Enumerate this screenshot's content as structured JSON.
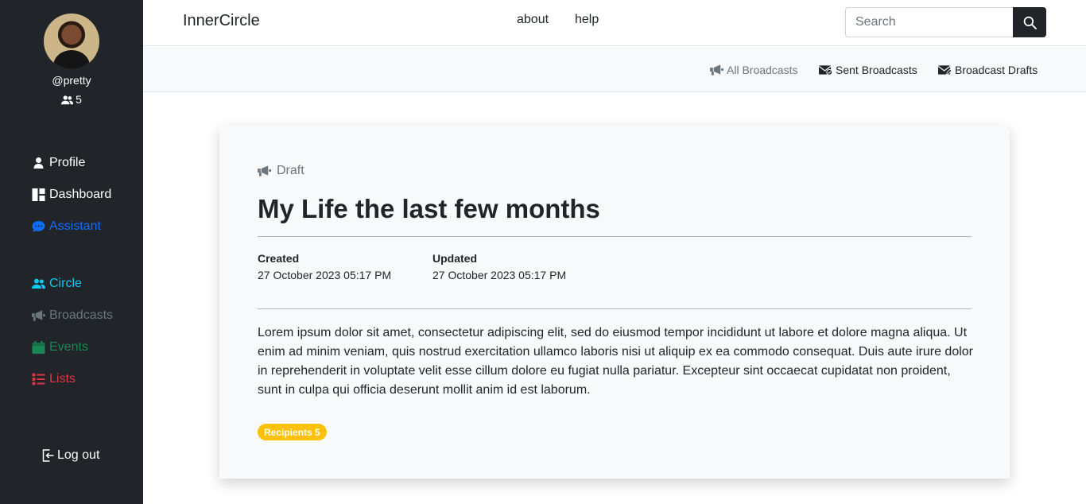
{
  "colors": {
    "sidebar_bg": "#212529",
    "primary": "#0d6efd",
    "info": "#0dcaf0",
    "secondary": "#6c757d",
    "success": "#198754",
    "danger": "#dc3545",
    "warning": "#ffc107"
  },
  "sidebar": {
    "username": "@pretty",
    "circle_count": "5",
    "items": [
      {
        "label": "Profile",
        "icon": "user-icon"
      },
      {
        "label": "Dashboard",
        "icon": "dashboard-icon"
      },
      {
        "label": "Assistant",
        "icon": "chat-icon"
      },
      {
        "label": "Circle",
        "icon": "users-icon"
      },
      {
        "label": "Broadcasts",
        "icon": "megaphone-icon"
      },
      {
        "label": "Events",
        "icon": "calendar-icon"
      },
      {
        "label": "Lists",
        "icon": "list-icon"
      }
    ],
    "logout": "Log out"
  },
  "header": {
    "brand": "InnerCircle",
    "links": [
      "about",
      "help"
    ],
    "search_placeholder": "Search"
  },
  "subnav": {
    "items": [
      "All Broadcasts",
      "Sent Broadcasts",
      "Broadcast Drafts"
    ]
  },
  "broadcast": {
    "status": "Draft",
    "title": "My Life the last few months",
    "created_label": "Created",
    "created_value": "27 October 2023 05:17 PM",
    "updated_label": "Updated",
    "updated_value": "27 October 2023 05:17 PM",
    "body": "Lorem ipsum dolor sit amet, consectetur adipiscing elit, sed do eiusmod tempor incididunt ut labore et dolore magna aliqua. Ut enim ad minim veniam, quis nostrud exercitation ullamco laboris nisi ut aliquip ex ea commodo consequat. Duis aute irure dolor in reprehenderit in voluptate velit esse cillum dolore eu fugiat nulla pariatur. Excepteur sint occaecat cupidatat non proident, sunt in culpa qui officia deserunt mollit anim id est laborum.",
    "recipients_badge": "Recipients 5"
  }
}
